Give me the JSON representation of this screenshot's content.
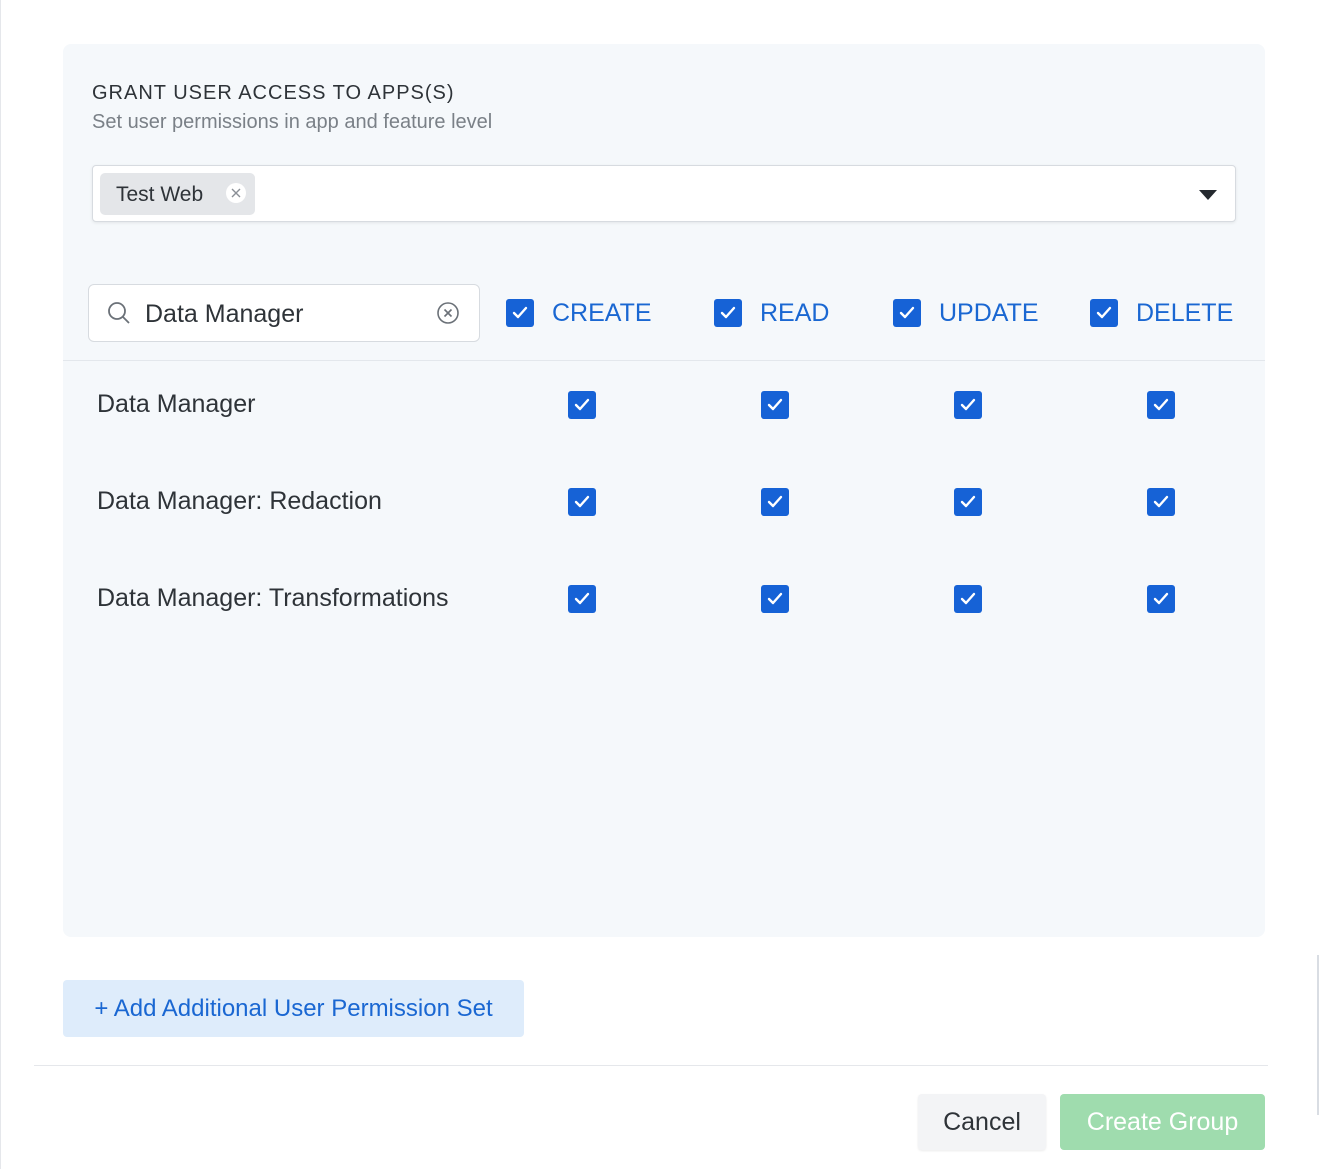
{
  "section": {
    "title": "GRANT USER ACCESS TO APPS(S)",
    "subtitle": "Set user permissions in app and feature level"
  },
  "app_select": {
    "selected": [
      {
        "label": "Test Web"
      }
    ],
    "remove_icon": "close-icon",
    "caret_icon": "caret-down-icon"
  },
  "search": {
    "value": "Data Manager",
    "placeholder": "Search",
    "icon": "search-icon",
    "clear_icon": "clear-circle-icon"
  },
  "columns": [
    {
      "label": "CREATE",
      "checked": true
    },
    {
      "label": "READ",
      "checked": true
    },
    {
      "label": "UPDATE",
      "checked": true
    },
    {
      "label": "DELETE",
      "checked": true
    }
  ],
  "rows": [
    {
      "label": "Data Manager",
      "permissions": [
        true,
        true,
        true,
        true
      ]
    },
    {
      "label": "Data Manager: Redaction",
      "permissions": [
        true,
        true,
        true,
        true
      ]
    },
    {
      "label": "Data Manager: Transformations",
      "permissions": [
        true,
        true,
        true,
        true
      ]
    }
  ],
  "add_permission_set_label": "+ Add Additional User Permission Set",
  "footer": {
    "cancel_label": "Cancel",
    "create_label": "Create Group"
  },
  "colors": {
    "accent": "#1662d6",
    "link": "#1a67d2",
    "create_disabled": "#9fdcae",
    "panel_bg": "#f5f8fb"
  }
}
